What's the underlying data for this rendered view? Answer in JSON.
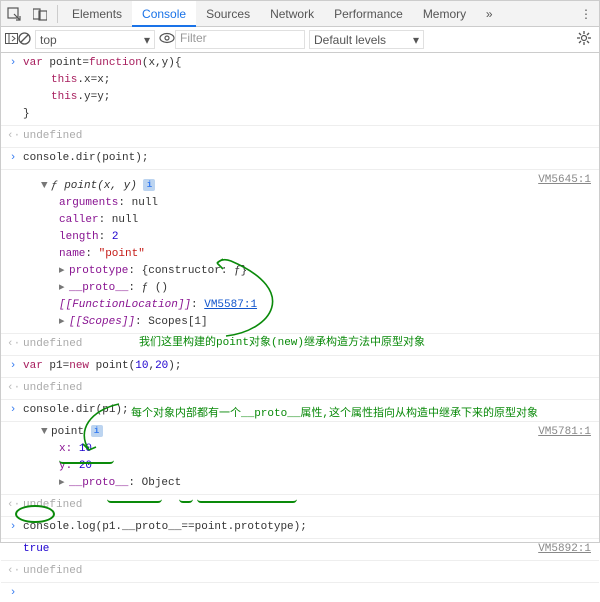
{
  "tabs": {
    "elements": "Elements",
    "console": "Console",
    "sources": "Sources",
    "network": "Network",
    "performance": "Performance",
    "memory": "Memory"
  },
  "toolbar": {
    "context": "top",
    "filter_placeholder": "Filter",
    "levels": "Default levels"
  },
  "input1": {
    "l1a": "var",
    "l1b": " point=",
    "l1c": "function",
    "l1d": "(x,y){",
    "l2a": "this",
    "l2b": ".x=x;",
    "l3a": "this",
    "l3b": ".y=y;",
    "l4": "}"
  },
  "undefined": "undefined",
  "input2": "console.dir(point);",
  "vm1": "VM5645:1",
  "tree1": {
    "head_f": "ƒ ",
    "head_sig": "point(x, y)",
    "arguments": "arguments",
    "arguments_v": ": null",
    "caller": "caller",
    "caller_v": ": null",
    "length": "length",
    "length_v": "2",
    "name": "name",
    "name_v": "\"point\"",
    "prototype": "prototype",
    "prototype_v": ": {constructor: ƒ}",
    "proto": "__proto__",
    "proto_v": ": ƒ ()",
    "floc": "[[FunctionLocation]]",
    "floc_v": "VM5587:1",
    "scopes": "[[Scopes]]",
    "scopes_v": ": Scopes[1]"
  },
  "anno1": "我们这里构建的point对象(new)继承构造方法中原型对象",
  "input3a": "var",
  "input3b": " p1=",
  "input3c": "new",
  "input3d": " point(",
  "input3e": "10",
  "input3f": ",",
  "input3g": "20",
  "input3h": ");",
  "input4": "console.dir(p1);",
  "vm2": "VM5781:1",
  "tree2": {
    "head": "point",
    "x": "x: ",
    "xv": "10",
    "y": "y: ",
    "yv": "20",
    "proto": "__proto__",
    "proto_v": ": Object"
  },
  "anno2": "每个对象内部都有一个__proto__属性,这个属性指向从构造中继承下来的原型对象",
  "input5": "console.log(p1.__proto__==point.prototype);",
  "vm3": "VM5892:1",
  "true": "true"
}
